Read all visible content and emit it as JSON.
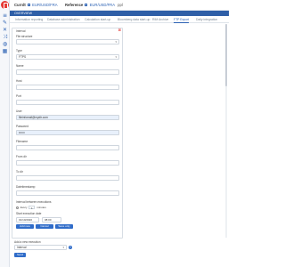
{
  "topbar": {
    "currency_label": "Currdt",
    "currency_value": "EUR/USD/FRA",
    "reference_label": "Reference",
    "reference_value": "EUR/USD/FRA",
    "user": "ppl"
  },
  "strip_title": "OVERVIEW",
  "tabs": [
    {
      "label": "Information reporting"
    },
    {
      "label": "Database administration"
    },
    {
      "label": "Calculation start-up"
    },
    {
      "label": "Bloomberg data start-up"
    },
    {
      "label": "RIM Archive"
    },
    {
      "label": "FTP Export"
    },
    {
      "label": "Daily integration"
    }
  ],
  "form": {
    "interval_label": "Interval",
    "file_structure_label": "File structure",
    "file_structure_value": "",
    "type_label": "Type",
    "type_value": "FTPS",
    "name_label": "Name",
    "host_label": "Host",
    "port_label": "Port",
    "user_label": "User",
    "user_value": "fileinfomail@mydir.com",
    "password_label": "Password",
    "password_value": "••••••",
    "filename_label": "Filename",
    "from_dir_label": "From dir",
    "to_dir_label": "To dir",
    "datetimestamp_label": "Datetimestamp",
    "interval_between_label": "Interval between executions",
    "radio_every": "Every",
    "radio_num": "1",
    "radio_unit": "minutes",
    "start_label": "Start execution date",
    "start_date": "01/10/2020",
    "start_time": "08:00",
    "btn_add": "Add new",
    "btn_cancel": "Cancel",
    "btn_save": "Save only"
  },
  "bottom": {
    "add_label": "Add a new execution",
    "select_value": "Interval",
    "send_btn": "Send"
  }
}
